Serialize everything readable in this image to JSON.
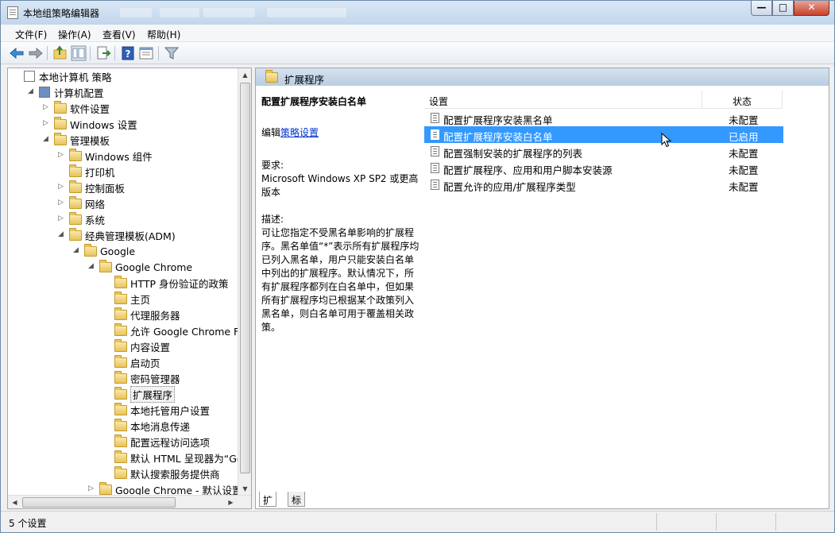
{
  "window": {
    "title": "本地组策略编辑器"
  },
  "menu": [
    "文件(F)",
    "操作(A)",
    "查看(V)",
    "帮助(H)"
  ],
  "toolbar": [
    "back-icon",
    "forward-icon",
    "up-folder-icon",
    "show-hide-tree-icon",
    "export-list-icon",
    "help-icon",
    "properties-icon",
    "filter-icon"
  ],
  "tree": {
    "items": [
      {
        "label": "本地计算机 策略",
        "depth": 0,
        "expander": "",
        "icon": "policy-doc-icon"
      },
      {
        "label": "计算机配置",
        "depth": 1,
        "expander": "◢",
        "icon": "computer-icon"
      },
      {
        "label": "软件设置",
        "depth": 2,
        "expander": "▷",
        "icon": "folder-icon"
      },
      {
        "label": "Windows 设置",
        "depth": 2,
        "expander": "▷",
        "icon": "folder-icon"
      },
      {
        "label": "管理模板",
        "depth": 2,
        "expander": "◢",
        "icon": "folder-icon"
      },
      {
        "label": "Windows 组件",
        "depth": 3,
        "expander": "▷",
        "icon": "folder-icon"
      },
      {
        "label": "打印机",
        "depth": 3,
        "expander": "",
        "icon": "folder-icon"
      },
      {
        "label": "控制面板",
        "depth": 3,
        "expander": "▷",
        "icon": "folder-icon"
      },
      {
        "label": "网络",
        "depth": 3,
        "expander": "▷",
        "icon": "folder-icon"
      },
      {
        "label": "系统",
        "depth": 3,
        "expander": "▷",
        "icon": "folder-icon"
      },
      {
        "label": "经典管理模板(ADM)",
        "depth": 3,
        "expander": "◢",
        "icon": "folder-icon"
      },
      {
        "label": "Google",
        "depth": 4,
        "expander": "◢",
        "icon": "folder-icon"
      },
      {
        "label": "Google Chrome",
        "depth": 5,
        "expander": "◢",
        "icon": "folder-icon"
      },
      {
        "label": "HTTP 身份验证的政策",
        "depth": 6,
        "expander": "",
        "icon": "folder-icon"
      },
      {
        "label": "主页",
        "depth": 6,
        "expander": "",
        "icon": "folder-icon"
      },
      {
        "label": "代理服务器",
        "depth": 6,
        "expander": "",
        "icon": "folder-icon"
      },
      {
        "label": "允许 Google Chrome Fram",
        "depth": 6,
        "expander": "",
        "icon": "folder-icon"
      },
      {
        "label": "内容设置",
        "depth": 6,
        "expander": "",
        "icon": "folder-icon"
      },
      {
        "label": "启动页",
        "depth": 6,
        "expander": "",
        "icon": "folder-icon"
      },
      {
        "label": "密码管理器",
        "depth": 6,
        "expander": "",
        "icon": "folder-icon"
      },
      {
        "label": "扩展程序",
        "depth": 6,
        "expander": "",
        "icon": "folder-icon",
        "selected": true
      },
      {
        "label": "本地托管用户设置",
        "depth": 6,
        "expander": "",
        "icon": "folder-icon"
      },
      {
        "label": "本地消息传递",
        "depth": 6,
        "expander": "",
        "icon": "folder-icon"
      },
      {
        "label": "配置远程访问选项",
        "depth": 6,
        "expander": "",
        "icon": "folder-icon"
      },
      {
        "label": "默认 HTML 呈现器为“Goo",
        "depth": 6,
        "expander": "",
        "icon": "folder-icon"
      },
      {
        "label": "默认搜索服务提供商",
        "depth": 6,
        "expander": "",
        "icon": "folder-icon"
      },
      {
        "label": "Google Chrome - 默认设置 (月",
        "depth": 5,
        "expander": "▷",
        "icon": "folder-icon"
      }
    ]
  },
  "right": {
    "header": "扩展程序",
    "desc": {
      "heading": "配置扩展程序安装白名单",
      "edit_prefix": "编辑",
      "edit_link": "策略设置",
      "req_label": "要求:",
      "req_text": "Microsoft Windows XP SP2 或更高版本",
      "desc_label": "描述:",
      "desc_text": "可让您指定不受黑名单影响的扩展程序。黑名单值“*”表示所有扩展程序均已列入黑名单，用户只能安装白名单中列出的扩展程序。默认情况下，所有扩展程序都列在白名单中，但如果所有扩展程序均已根据某个政策列入黑名单，则白名单可用于覆盖相关政策。"
    },
    "columns": {
      "setting": "设置",
      "state": "状态"
    },
    "rows": [
      {
        "name": "配置扩展程序安装黑名单",
        "state": "未配置"
      },
      {
        "name": "配置扩展程序安装白名单",
        "state": "已启用",
        "selected": true
      },
      {
        "name": "配置强制安装的扩展程序的列表",
        "state": "未配置"
      },
      {
        "name": "配置扩展程序、应用和用户脚本安装源",
        "state": "未配置"
      },
      {
        "name": "配置允许的应用/扩展程序类型",
        "state": "未配置"
      }
    ],
    "tabs": [
      "扩展",
      "标准"
    ]
  },
  "status": {
    "text": "5 个设置"
  },
  "colors": {
    "selection": "#3399ff",
    "link": "#0033cc"
  }
}
